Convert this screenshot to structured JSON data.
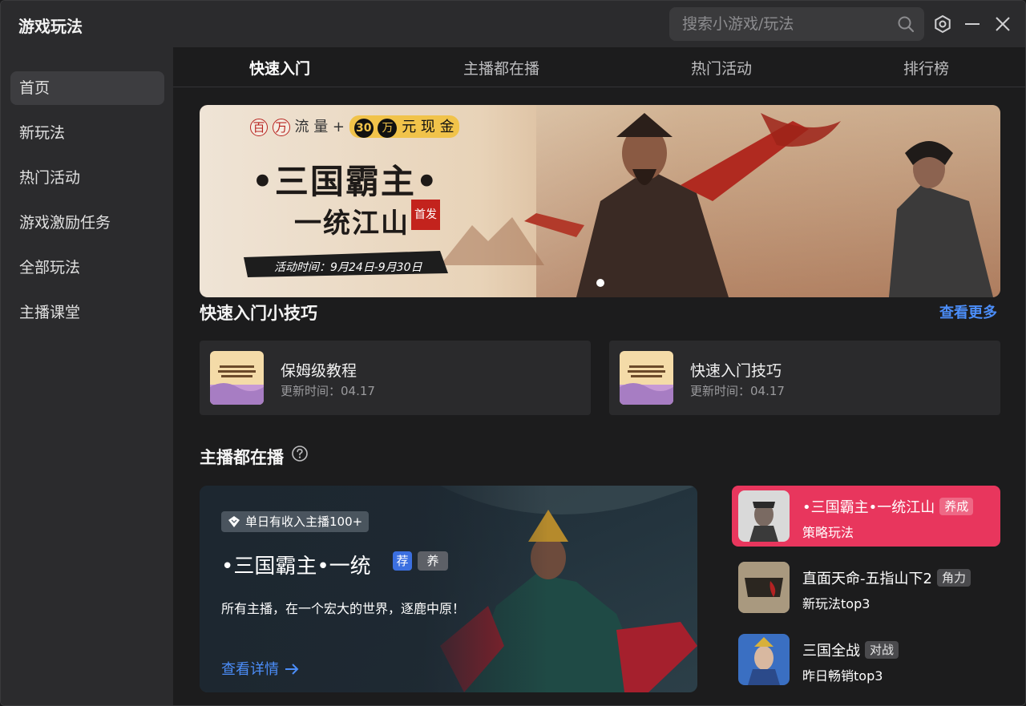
{
  "window": {
    "title": "游戏玩法"
  },
  "search": {
    "placeholder": "搜索小游戏/玩法"
  },
  "sidebar": {
    "items": [
      {
        "label": "首页"
      },
      {
        "label": "新玩法"
      },
      {
        "label": "热门活动"
      },
      {
        "label": "游戏激励任务"
      },
      {
        "label": "全部玩法"
      },
      {
        "label": "主播课堂"
      }
    ]
  },
  "tabs": [
    {
      "label": "快速入门"
    },
    {
      "label": "主播都在播"
    },
    {
      "label": "热门活动"
    },
    {
      "label": "排行榜"
    }
  ],
  "banner": {
    "top_chars": [
      "百",
      "万"
    ],
    "top_text_1": "流 量 +",
    "top_num": "30",
    "top_wan": "万",
    "top_text_2": "元 现 金",
    "title_line1": "•三国霸主•",
    "title_line2": "一统江山",
    "stamp": "首发",
    "date": "活动时间：9月24日-9月30日"
  },
  "tips": {
    "title": "快速入门小技巧",
    "more": "查看更多",
    "cards": [
      {
        "title": "保姆级教程",
        "updated": "更新时间：04.17"
      },
      {
        "title": "快速入门技巧",
        "updated": "更新时间：04.17"
      }
    ]
  },
  "streamers": {
    "title": "主播都在播",
    "feature": {
      "badge": "单日有收入主播100+",
      "title": "•三国霸主•一统江山",
      "tag1": "荐",
      "tag2": "养",
      "desc": "所有主播，在一个宏大的世界，逐鹿中原！",
      "link": "查看详情"
    },
    "list": [
      {
        "name": "•三国霸主•一统江山",
        "tag": "养成",
        "sub": "策略玩法"
      },
      {
        "name": "直面天命-五指山下2",
        "tag": "角力",
        "sub": "新玩法top3"
      },
      {
        "name": "三国全战",
        "tag": "对战",
        "sub": "昨日畅销top3"
      }
    ]
  },
  "colors": {
    "accent": "#4b8df8",
    "highlight": "#e8365d"
  }
}
